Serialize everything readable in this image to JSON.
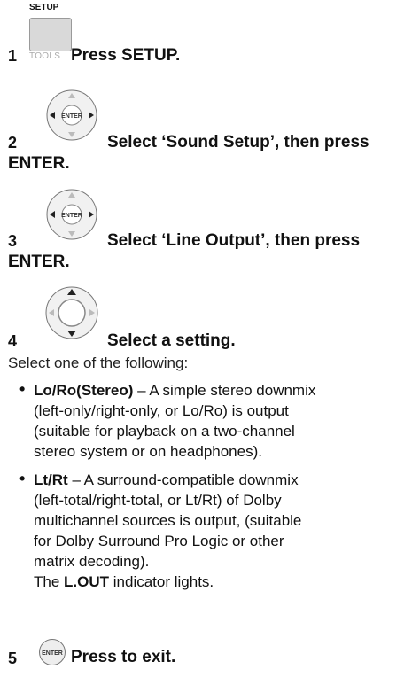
{
  "step1": {
    "number": "1",
    "key_label_top": "SETUP",
    "key_label_bottom": "TOOLS",
    "instruction": "Press SETUP."
  },
  "step2": {
    "number": "2",
    "center_label": "ENTER",
    "instruction": "Select ‘Sound Setup’, then press",
    "instruction_cont": "ENTER."
  },
  "step3": {
    "number": "3",
    "center_label": "ENTER",
    "instruction": "Select ‘Line Output’, then press",
    "instruction_cont": "ENTER."
  },
  "step4": {
    "number": "4",
    "instruction": "Select a setting.",
    "intro": "Select one of the following:",
    "options": [
      {
        "term": "Lo/Ro(Stereo)",
        "lines": [
          " – A simple stereo downmix",
          "(left-only/right-only, or Lo/Ro) is output",
          "(suitable for playback on a two-channel",
          "stereo system or on headphones)."
        ]
      },
      {
        "term": "Lt/Rt",
        "lines": [
          " – A surround-compatible downmix",
          "(left-total/right-total, or Lt/Rt) of Dolby",
          "multichannel sources is output, (suitable",
          "for Dolby Surround Pro Logic or other",
          "matrix decoding)."
        ],
        "note_prefix": "The ",
        "note_bold": "L.OUT",
        "note_suffix": " indicator lights."
      }
    ]
  },
  "step5": {
    "number": "5",
    "button_label": "ENTER",
    "instruction": "Press to exit."
  }
}
